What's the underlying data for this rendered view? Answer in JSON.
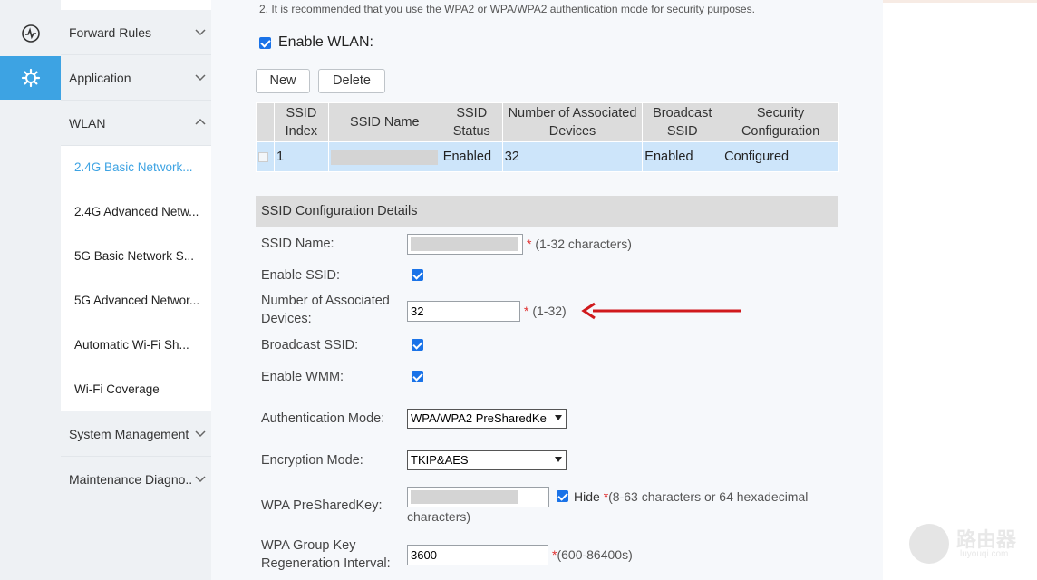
{
  "notice": "2. It is recommended that you use the WPA2 or WPA/WPA2 authentication mode for security purposes.",
  "rail": {
    "icons": [
      "status-icon",
      "gear-icon"
    ],
    "active_color": "#3da3e3"
  },
  "menu": {
    "groups": [
      {
        "label": "Forward Rules"
      },
      {
        "label": "Application"
      },
      {
        "label": "WLAN"
      },
      {
        "label": "System Management"
      },
      {
        "label": "Maintenance Diagno.."
      }
    ],
    "wlan_items": [
      {
        "label": "2.4G Basic Network..."
      },
      {
        "label": "2.4G Advanced Netw..."
      },
      {
        "label": "5G Basic Network S..."
      },
      {
        "label": "5G Advanced Networ..."
      },
      {
        "label": "Automatic Wi-Fi Sh..."
      },
      {
        "label": "Wi-Fi Coverage"
      }
    ]
  },
  "wlan": {
    "enable_label": "Enable WLAN:",
    "enabled": true,
    "new_label": "New",
    "delete_label": "Delete"
  },
  "table": {
    "headers": {
      "index_1": "SSID",
      "index_2": "Index",
      "name": "SSID Name",
      "status_1": "SSID",
      "status_2": "Status",
      "assoc_1": "Number of Associated",
      "assoc_2": "Devices",
      "broadcast_1": "Broadcast",
      "broadcast_2": "SSID",
      "security_1": "Security",
      "security_2": "Configuration"
    },
    "rows": [
      {
        "index": "1",
        "status": "Enabled",
        "assoc": "32",
        "broadcast": "Enabled",
        "security": "Configured"
      }
    ]
  },
  "details": {
    "title": "SSID Configuration Details",
    "ssid_name_label": "SSID Name:",
    "ssid_name_hint": "(1-32 characters)",
    "enable_ssid_label": "Enable SSID:",
    "assoc_label_1": "Number of Associated",
    "assoc_label_2": "Devices:",
    "assoc_value": "32",
    "assoc_hint": "(1-32)",
    "broadcast_label": "Broadcast SSID:",
    "wmm_label": "Enable WMM:",
    "auth_label": "Authentication Mode:",
    "auth_value": "WPA/WPA2 PreSharedKe",
    "enc_label": "Encryption Mode:",
    "enc_value": "TKIP&AES",
    "psk_label": "WPA PreSharedKey:",
    "hide_label": "Hide",
    "psk_hint_1": "(8-63 characters or 64 hexadecimal",
    "psk_hint_2": "characters)",
    "regen_label_1": "WPA Group Key",
    "regen_label_2": "Regeneration Interval:",
    "regen_value": "3600",
    "regen_hint": "(600-86400s)",
    "required_mark": "*"
  },
  "watermark": {
    "line1": "路由器",
    "line2": "luyouqi.com"
  },
  "annotation_color": "#d0191c"
}
